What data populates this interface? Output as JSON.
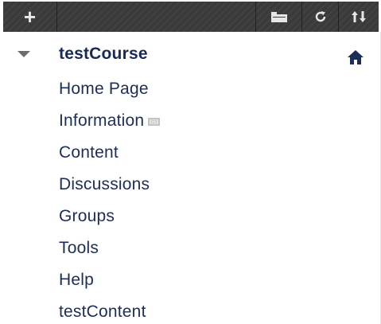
{
  "toolbar": {
    "add_icon": "plus-icon",
    "folder_icon": "folder-icon",
    "refresh_icon": "refresh-icon",
    "sort_icon": "sort-arrows-icon"
  },
  "course": {
    "title": "testCourse",
    "expand_icon": "caret-down-icon",
    "home_icon": "home-icon"
  },
  "menu": {
    "items": [
      {
        "label": "Home Page"
      },
      {
        "label": "Information",
        "icon": "unavailable-icon"
      },
      {
        "label": "Content"
      },
      {
        "label": "Discussions"
      },
      {
        "label": "Groups"
      },
      {
        "label": "Tools"
      },
      {
        "label": "Help"
      },
      {
        "label": "testContent"
      }
    ]
  },
  "colors": {
    "toolbar_bg": "#3a3a3a",
    "link_text": "#1d2d5a",
    "course_text": "#1a2a57"
  }
}
